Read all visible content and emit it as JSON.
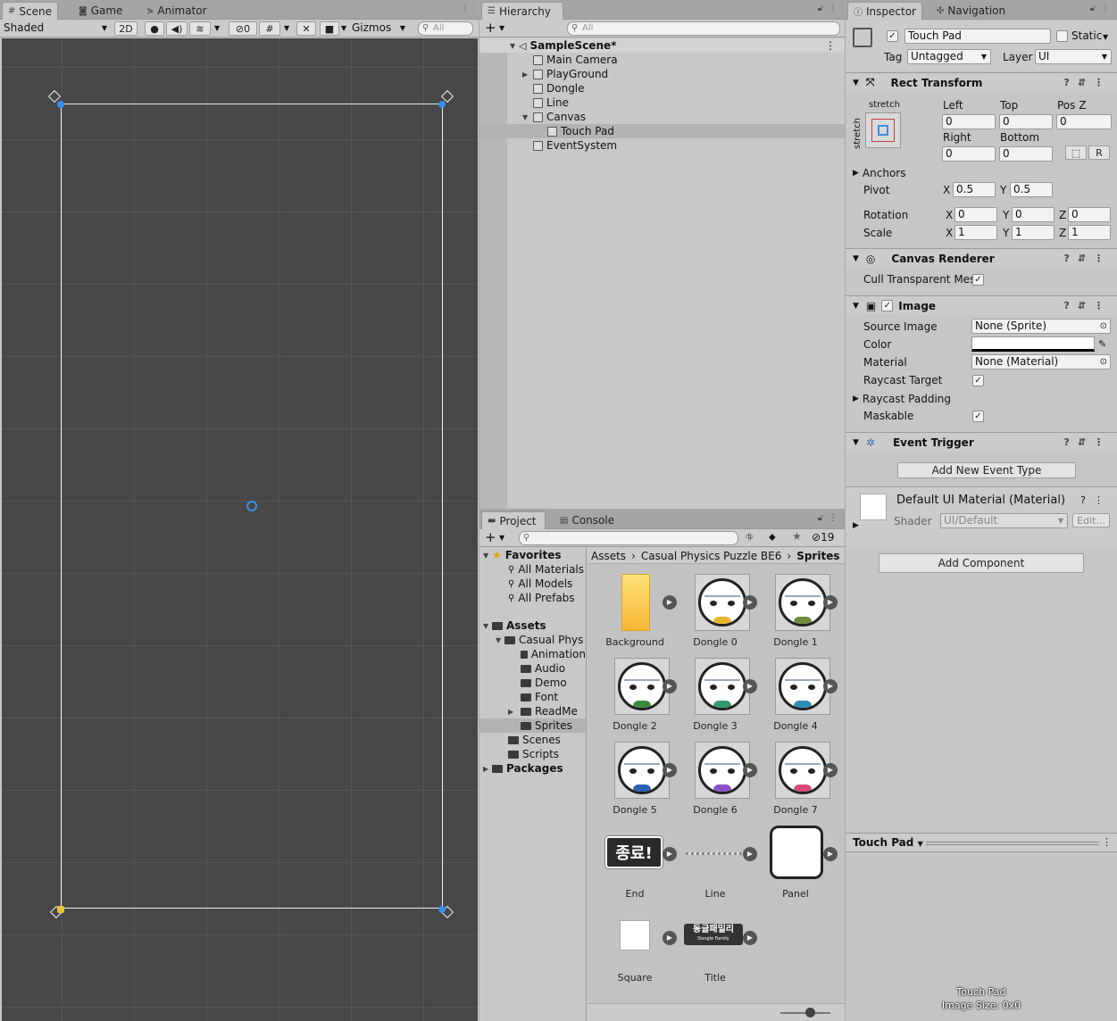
{
  "scene_panel": {
    "tabs": [
      "Scene",
      "Game",
      "Animator"
    ],
    "shading_mode": "Shaded",
    "btn_2d": "2D",
    "hidden_count": "0",
    "gizmos_label": "Gizmos",
    "search_placeholder": "All"
  },
  "hierarchy": {
    "tab": "Hierarchy",
    "search_placeholder": "All",
    "scene_name": "SampleScene*",
    "items": [
      "Main Camera",
      "PlayGround",
      "Dongle",
      "Line",
      "Canvas",
      "Touch Pad",
      "EventSystem"
    ],
    "selected": "Touch Pad"
  },
  "project": {
    "tabs": [
      "Project",
      "Console"
    ],
    "hidden_count": "19",
    "breadcrumb": [
      "Assets",
      "Casual Physics Puzzle BE6",
      "Sprites"
    ],
    "favorites_label": "Favorites",
    "favorites": [
      "All Materials",
      "All Models",
      "All Prefabs"
    ],
    "assets_label": "Assets",
    "tree": [
      "Casual Phys",
      "Animation",
      "Audio",
      "Demo",
      "Font",
      "ReadMe",
      "Sprites",
      "Scenes",
      "Scripts"
    ],
    "packages_label": "Packages",
    "assets": [
      "Background",
      "Dongle 0",
      "Dongle 1",
      "Dongle 2",
      "Dongle 3",
      "Dongle 4",
      "Dongle 5",
      "Dongle 6",
      "Dongle 7",
      "End",
      "Line",
      "Panel",
      "Square",
      "Title"
    ],
    "end_thumb_text": "종료!",
    "title_thumb_text": "동글패밀리",
    "title_thumb_sub": "Dongle Family"
  },
  "inspector": {
    "tabs": [
      "Inspector",
      "Navigation"
    ],
    "object_name": "Touch Pad",
    "static_label": "Static",
    "tag_label": "Tag",
    "tag_value": "Untagged",
    "layer_label": "Layer",
    "layer_value": "UI",
    "rect_transform": {
      "title": "Rect Transform",
      "stretch_h": "stretch",
      "stretch_v": "stretch",
      "left_label": "Left",
      "left": "0",
      "top_label": "Top",
      "top": "0",
      "posz_label": "Pos Z",
      "posz": "0",
      "right_label": "Right",
      "right": "0",
      "bottom_label": "Bottom",
      "bottom": "0",
      "r_btn": "R",
      "anchors_label": "Anchors",
      "pivot_label": "Pivot",
      "pivot_x": "0.5",
      "pivot_y": "0.5",
      "rotation_label": "Rotation",
      "rot_x": "0",
      "rot_y": "0",
      "rot_z": "0",
      "scale_label": "Scale",
      "scale_x": "1",
      "scale_y": "1",
      "scale_z": "1",
      "x": "X",
      "y": "Y",
      "z": "Z"
    },
    "canvas_renderer": {
      "title": "Canvas Renderer",
      "cull_label": "Cull Transparent Mes"
    },
    "image": {
      "title": "Image",
      "source_label": "Source Image",
      "source_value": "None (Sprite)",
      "color_label": "Color",
      "material_label": "Material",
      "material_value": "None (Material)",
      "raycast_target_label": "Raycast Target",
      "raycast_padding_label": "Raycast Padding",
      "maskable_label": "Maskable"
    },
    "event_trigger": {
      "title": "Event Trigger",
      "add_button": "Add New Event Type"
    },
    "material": {
      "title": "Default UI Material (Material)",
      "shader_label": "Shader",
      "shader_value": "UI/Default",
      "edit_button": "Edit..."
    },
    "add_component": "Add Component",
    "preview_title": "Touch Pad",
    "preview_name": "Touch Pad",
    "preview_size": "Image Size: 0x0"
  }
}
